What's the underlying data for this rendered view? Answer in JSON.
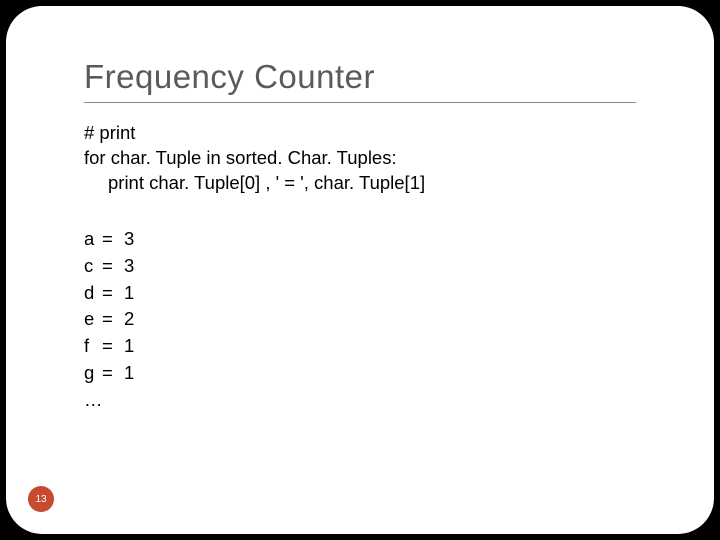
{
  "title": "Frequency Counter",
  "code": {
    "line1": "# print",
    "line2": "for char. Tuple in sorted. Char. Tuples:",
    "line3": "print char. Tuple[0] , ' = ', char. Tuple[1]"
  },
  "output": {
    "eq": "=",
    "rows": [
      {
        "key": "a",
        "val": "3"
      },
      {
        "key": "c",
        "val": "3"
      },
      {
        "key": "d",
        "val": "1"
      },
      {
        "key": "e",
        "val": "2"
      },
      {
        "key": "f",
        "val": "1"
      },
      {
        "key": "g",
        "val": "1"
      }
    ],
    "ellipsis": "…"
  },
  "page_number": "13"
}
